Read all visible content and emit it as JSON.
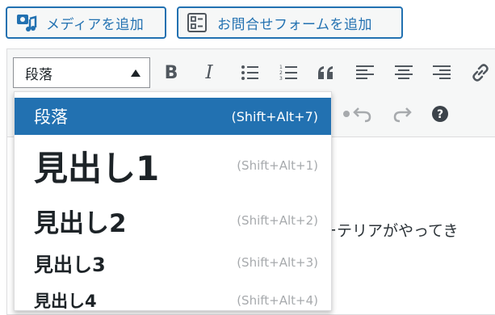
{
  "buttons": {
    "add_media": "メディアを追加",
    "add_contact_form": "お問合せフォームを追加"
  },
  "toolbar": {
    "format_select_value": "段落",
    "bold_label": "B",
    "italic_label": "I",
    "icons": [
      "bold-icon",
      "italic-icon",
      "bulleted-list-icon",
      "numbered-list-icon",
      "blockquote-icon",
      "align-left-icon",
      "align-center-icon",
      "align-right-icon",
      "link-icon",
      "undo-icon",
      "redo-icon",
      "help-icon"
    ]
  },
  "format_menu": {
    "items": [
      {
        "label": "段落",
        "shortcut": "(Shift+Alt+7)",
        "selected": true
      },
      {
        "label": "見出し1",
        "shortcut": "(Shift+Alt+1)",
        "selected": false
      },
      {
        "label": "見出し2",
        "shortcut": "(Shift+Alt+2)",
        "selected": false
      },
      {
        "label": "見出し3",
        "shortcut": "(Shift+Alt+3)",
        "selected": false
      },
      {
        "label": "見出し4",
        "shortcut": "(Shift+Alt+4)",
        "selected": false
      }
    ]
  },
  "editor": {
    "visible_text": "ーテリアがやってき"
  },
  "colors": {
    "accent": "#2271b1",
    "toolbar_bg": "#f6f7f7",
    "icon": "#50575e"
  }
}
